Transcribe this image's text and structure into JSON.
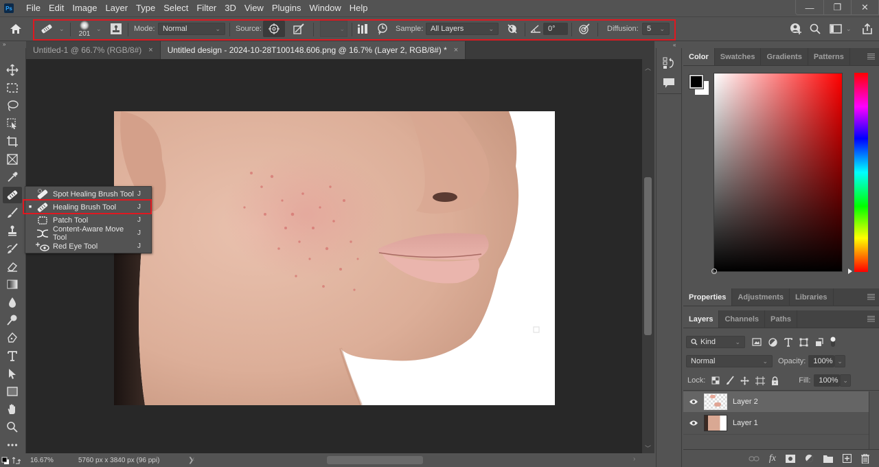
{
  "app": {
    "logo": "Ps"
  },
  "menubar": {
    "items": [
      "File",
      "Edit",
      "Image",
      "Layer",
      "Type",
      "Select",
      "Filter",
      "3D",
      "View",
      "Plugins",
      "Window",
      "Help"
    ]
  },
  "window_controls": {
    "minimize": "—",
    "restore": "❐",
    "close": "✕"
  },
  "options_bar": {
    "brush_size": "201",
    "mode_label": "Mode:",
    "mode_value": "Normal",
    "source_label": "Source:",
    "sample_label": "Sample:",
    "sample_value": "All Layers",
    "angle_value": "0°",
    "diffusion_label": "Diffusion:",
    "diffusion_value": "5",
    "highlight_color": "#e01820"
  },
  "tabs": [
    {
      "label": "Untitled-1 @ 66.7% (RGB/8#)",
      "close": "×",
      "active": false
    },
    {
      "label": "Untitled design - 2024-10-28T100148.606.png @ 16.7% (Layer 2, RGB/8#) *",
      "close": "×",
      "active": true
    }
  ],
  "tool_flyout": {
    "items": [
      {
        "label": "Spot Healing Brush Tool",
        "shortcut": "J",
        "icon": "spot-healing-brush-icon",
        "selected": false
      },
      {
        "label": "Healing Brush Tool",
        "shortcut": "J",
        "icon": "healing-brush-icon",
        "selected": true
      },
      {
        "label": "Patch Tool",
        "shortcut": "J",
        "icon": "patch-icon",
        "selected": false
      },
      {
        "label": "Content-Aware Move Tool",
        "shortcut": "J",
        "icon": "content-aware-move-icon",
        "selected": false
      },
      {
        "label": "Red Eye Tool",
        "shortcut": "J",
        "icon": "red-eye-icon",
        "selected": false
      }
    ],
    "selected_marker": "■"
  },
  "status": {
    "zoom": "16.67%",
    "doc_info": "5760 px x 3840 px (96 ppi)",
    "arrow": "❯"
  },
  "color_panel": {
    "tabs": [
      "Color",
      "Swatches",
      "Gradients",
      "Patterns"
    ],
    "active_tab": "Color",
    "foreground": "#000000",
    "background": "#ffffff"
  },
  "properties_panel": {
    "tabs": [
      "Properties",
      "Adjustments",
      "Libraries"
    ],
    "active_tab": "Properties"
  },
  "layers_panel": {
    "tabs": [
      "Layers",
      "Channels",
      "Paths"
    ],
    "active_tab": "Layers",
    "filter_kind": "Kind",
    "blend_mode": "Normal",
    "opacity_label": "Opacity:",
    "opacity_value": "100%",
    "lock_label": "Lock:",
    "fill_label": "Fill:",
    "fill_value": "100%",
    "layers": [
      {
        "name": "Layer 2",
        "visible": true,
        "selected": true
      },
      {
        "name": "Layer 1",
        "visible": true,
        "selected": false
      }
    ]
  }
}
